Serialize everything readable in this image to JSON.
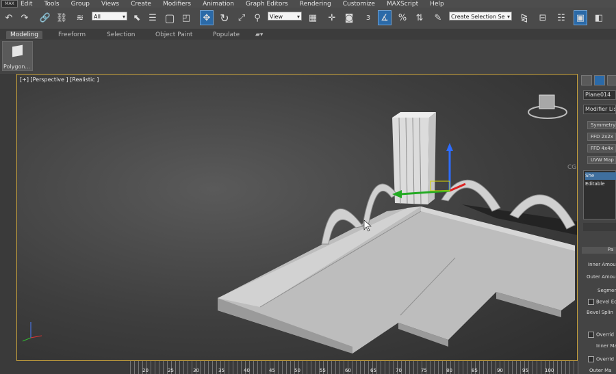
{
  "menu": [
    "Edit",
    "Tools",
    "Group",
    "Views",
    "Create",
    "Modifiers",
    "Animation",
    "Graph Editors",
    "Rendering",
    "Customize",
    "MAXScript",
    "Help"
  ],
  "logo_text": "MAX",
  "toolbar": {
    "selection_filter": "All",
    "ref_coord": "View",
    "snap_label": "3",
    "named_selection": "Create Selection Se",
    "icons": [
      "undo-icon",
      "redo-icon",
      "link-icon",
      "unlink-icon",
      "bind-space-warp-icon",
      "select-object-icon",
      "select-by-name-icon",
      "rect-select-icon",
      "window-crossing-icon",
      "move-icon",
      "rotate-icon",
      "scale-icon",
      "manipulate-icon",
      "mirror-icon",
      "align-icon",
      "render-setup-icon",
      "render-icon"
    ]
  },
  "ribbon_tabs": [
    "Modeling",
    "Freeform",
    "Selection",
    "Object Paint",
    "Populate"
  ],
  "ribbon_panel": {
    "button_label": "Polygon..."
  },
  "viewport": {
    "label": "[+] [Perspective ] [Realistic ]",
    "watermark": "CG自学网"
  },
  "right_panel": {
    "object_name": "Plane014",
    "modifier_list": "Modifier List",
    "buttons": [
      "Symmetry",
      "FFD 2x2x",
      "FFD 4x4x",
      "UVW Map"
    ],
    "stack_items": [
      "She",
      "Editable"
    ],
    "rollout_title": "Pa",
    "params": [
      "Inner Amou",
      "Outer Amou",
      "Segmen",
      "Bevel Ed",
      "Bevel Splin",
      "Overrid",
      "Inner Ma",
      "Overrid",
      "Outer Ma"
    ]
  },
  "timeline": {
    "ticks": [
      "20",
      "25",
      "30",
      "35",
      "40",
      "45",
      "50",
      "55",
      "60",
      "65",
      "70",
      "75",
      "80",
      "85",
      "90",
      "95",
      "100"
    ]
  }
}
